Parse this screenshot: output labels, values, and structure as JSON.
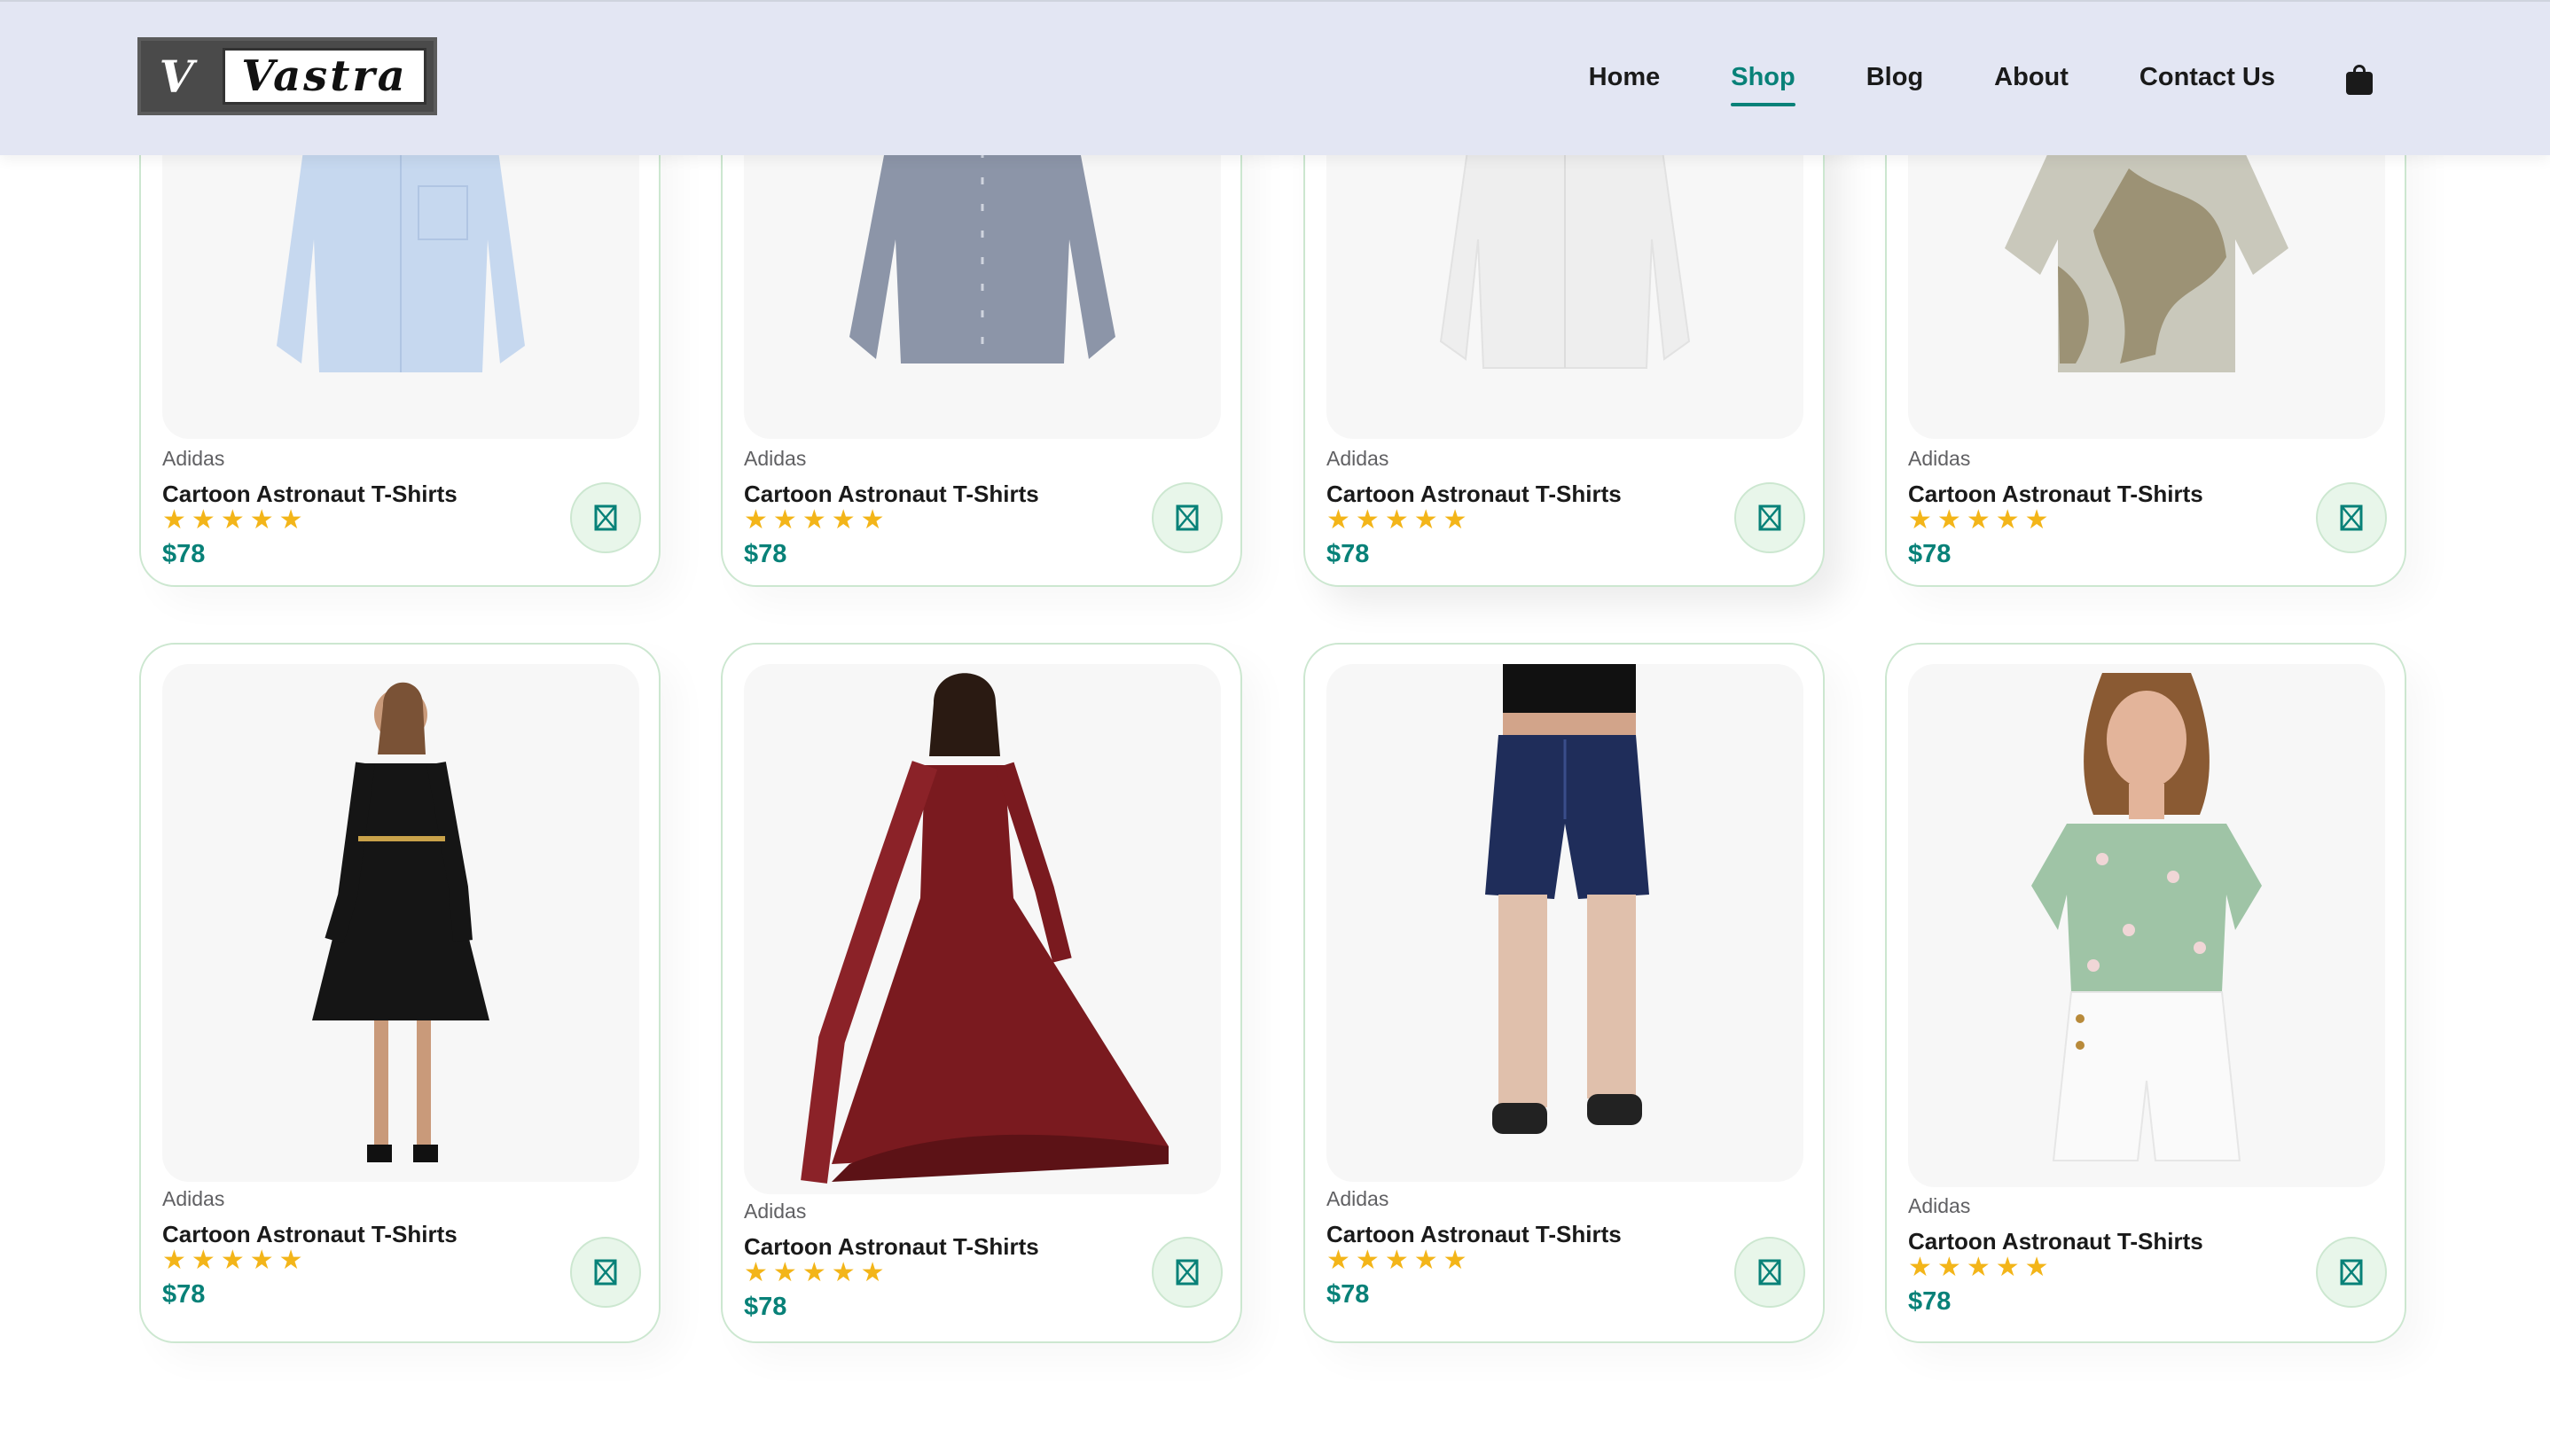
{
  "header": {
    "logo_letter": "V",
    "logo_text": "Vastra",
    "nav": [
      "Home",
      "Shop",
      "Blog",
      "About",
      "Contact Us"
    ],
    "active_nav": "Shop",
    "cart_icon": "shopping-bag-icon"
  },
  "products": [
    {
      "brand": "Adidas",
      "title": "Cartoon Astronaut T-Shirts",
      "rating": 5,
      "price": "$78",
      "image": "light blue shirt"
    },
    {
      "brand": "Adidas",
      "title": "Cartoon Astronaut T-Shirts",
      "rating": 5,
      "price": "$78",
      "image": "striped grey shirt"
    },
    {
      "brand": "Adidas",
      "title": "Cartoon Astronaut T-Shirts",
      "rating": 5,
      "price": "$78",
      "image": "white shirt"
    },
    {
      "brand": "Adidas",
      "title": "Cartoon Astronaut T-Shirts",
      "rating": 5,
      "price": "$78",
      "image": "printed short-sleeve shirt"
    },
    {
      "brand": "Adidas",
      "title": "Cartoon Astronaut T-Shirts",
      "rating": 5,
      "price": "$78",
      "image": "black dress"
    },
    {
      "brand": "Adidas",
      "title": "Cartoon Astronaut T-Shirts",
      "rating": 5,
      "price": "$78",
      "image": "maroon anarkali gown"
    },
    {
      "brand": "Adidas",
      "title": "Cartoon Astronaut T-Shirts",
      "rating": 5,
      "price": "$78",
      "image": "denim shorts"
    },
    {
      "brand": "Adidas",
      "title": "Cartoon Astronaut T-Shirts",
      "rating": 5,
      "price": "$78",
      "image": "floral blouse and white shorts"
    }
  ],
  "colors": {
    "accent": "#088178",
    "star": "#f3b519",
    "card_border": "#cce7d0",
    "header_bg": "#e3e6f3"
  }
}
